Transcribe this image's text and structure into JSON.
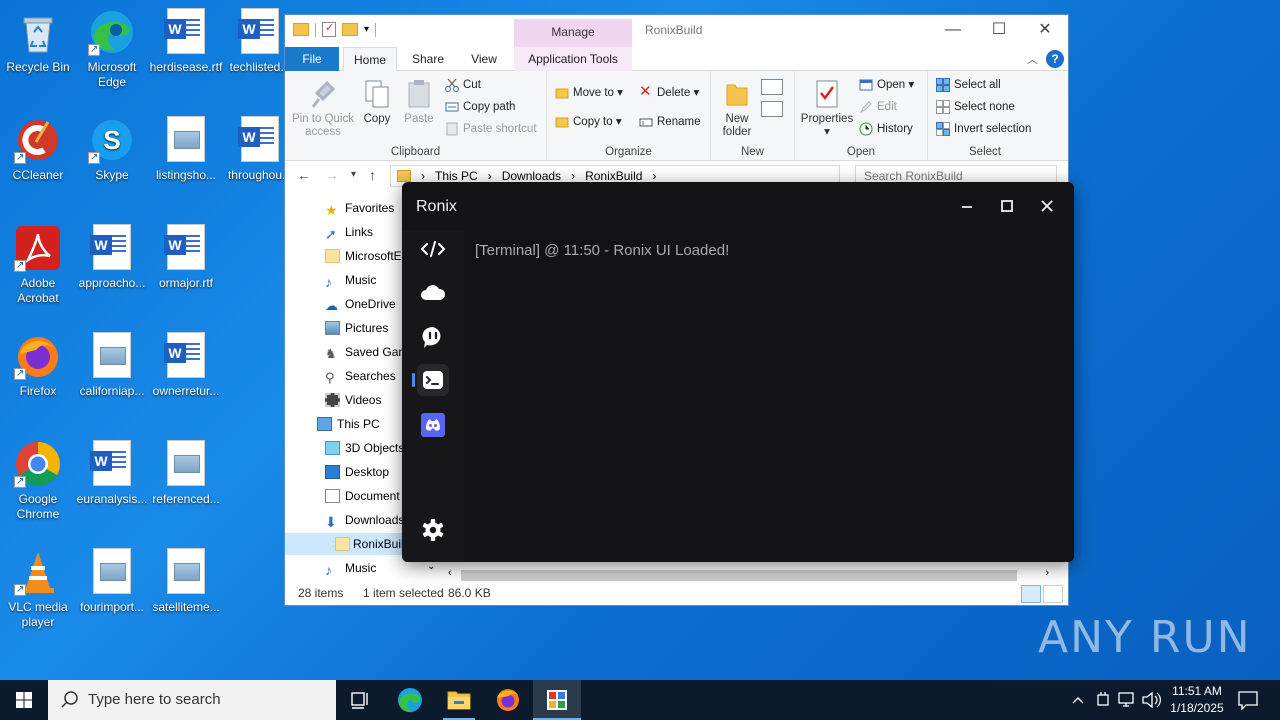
{
  "desktop": {
    "icons": [
      {
        "label": "Recycle Bin"
      },
      {
        "label": "Microsoft Edge"
      },
      {
        "label": "herdisease.rtf"
      },
      {
        "label": "techlisted..."
      },
      {
        "label": "CCleaner"
      },
      {
        "label": "Skype"
      },
      {
        "label": "listingsho..."
      },
      {
        "label": "throughou..."
      },
      {
        "label": "Adobe Acrobat"
      },
      {
        "label": "approacho..."
      },
      {
        "label": "ormajor.rtf"
      },
      {
        "label": "Firefox"
      },
      {
        "label": "californiap..."
      },
      {
        "label": "ownerretur..."
      },
      {
        "label": "Google Chrome"
      },
      {
        "label": "euranalysis..."
      },
      {
        "label": "referenced..."
      },
      {
        "label": "VLC media player"
      },
      {
        "label": "fourimport..."
      },
      {
        "label": "satelliteme..."
      }
    ]
  },
  "explorer": {
    "title": "RonixBuild",
    "contextual_tab_header": "Manage",
    "tabs": [
      "File",
      "Home",
      "Share",
      "View",
      "Application Tools"
    ],
    "ribbon": {
      "clipboard": {
        "label": "Clipboard",
        "pin": "Pin to Quick access",
        "copy": "Copy",
        "paste": "Paste",
        "cut": "Cut",
        "copy_path": "Copy path",
        "paste_shortcut": "Paste shortcut"
      },
      "organize": {
        "label": "Organize",
        "move_to": "Move to",
        "copy_to": "Copy to",
        "delete": "Delete",
        "rename": "Rename"
      },
      "new": {
        "label": "New",
        "new_folder": "New folder"
      },
      "open": {
        "label": "Open",
        "properties": "Properties",
        "open": "Open",
        "edit": "Edit",
        "history": "History"
      },
      "select": {
        "label": "Select",
        "select_all": "Select all",
        "select_none": "Select none",
        "invert": "Invert selection"
      }
    },
    "address": {
      "crumbs": [
        "This PC",
        "Downloads",
        "RonixBuild"
      ],
      "search_placeholder": "Search RonixBuild"
    },
    "nav": [
      {
        "label": "Favorites"
      },
      {
        "label": "Links"
      },
      {
        "label": "MicrosoftE"
      },
      {
        "label": "Music"
      },
      {
        "label": "OneDrive"
      },
      {
        "label": "Pictures"
      },
      {
        "label": "Saved Gam"
      },
      {
        "label": "Searches"
      },
      {
        "label": "Videos"
      },
      {
        "label": "This PC"
      },
      {
        "label": "3D Objects"
      },
      {
        "label": "Desktop"
      },
      {
        "label": "Document"
      },
      {
        "label": "Downloads"
      },
      {
        "label": "RonixBuil"
      },
      {
        "label": "Music"
      }
    ],
    "status": {
      "items": "28 items",
      "selected": "1 item selected",
      "size": "86.0 KB"
    }
  },
  "ronix": {
    "title": "Ronix",
    "terminal_message": "[Terminal] @ 11:50 - Ronix UI Loaded!",
    "sidebar": [
      "code-icon",
      "cloud-icon",
      "chat-icon",
      "terminal-icon",
      "discord-icon",
      "settings-icon"
    ],
    "accent": "#4a8cf0",
    "discord_color": "#5865f2"
  },
  "taskbar": {
    "search_placeholder": "Type here to search",
    "time": "11:51 AM",
    "date": "1/18/2025"
  },
  "watermark": "ANY RUN"
}
